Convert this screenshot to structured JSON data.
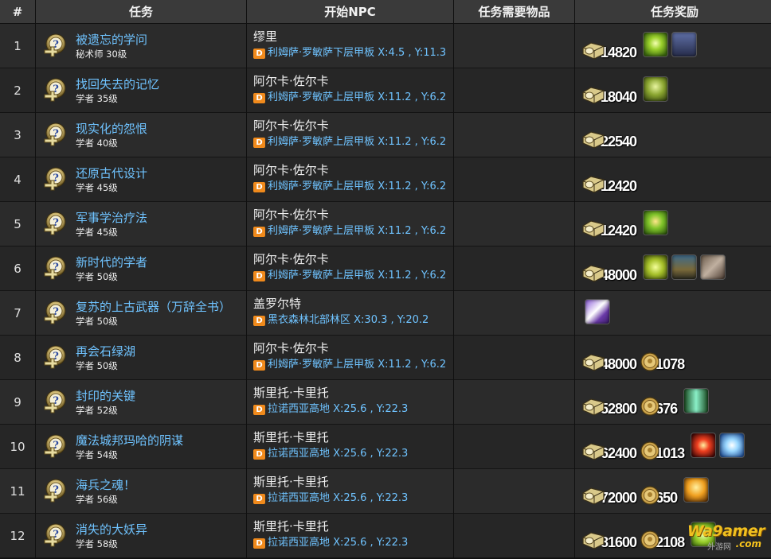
{
  "headers": {
    "num": "#",
    "quest": "任务",
    "npc": "开始NPC",
    "items": "任务需要物品",
    "reward": "任务奖励"
  },
  "rows": [
    {
      "num": "1",
      "name": "被遗忘的学问",
      "sub": "秘术师 30级",
      "npc": "缪里",
      "loc": "利姆萨·罗敏萨下层甲板 X:4.5 , Y:11.3",
      "rewards": [
        {
          "type": "gil",
          "value": "14820"
        }
      ],
      "items": [
        "item-green-burst",
        "item-blue-hat"
      ]
    },
    {
      "num": "2",
      "name": "找回失去的记忆",
      "sub": "学者 35级",
      "npc": "阿尔卡·佐尔卡",
      "loc": "利姆萨·罗敏萨上层甲板 X:11.2 , Y:6.2",
      "rewards": [
        {
          "type": "gil",
          "value": "18040"
        }
      ],
      "items": [
        "item-green-figure"
      ]
    },
    {
      "num": "3",
      "name": "现实化的怨恨",
      "sub": "学者 40级",
      "npc": "阿尔卡·佐尔卡",
      "loc": "利姆萨·罗敏萨上层甲板 X:11.2 , Y:6.2",
      "rewards": [
        {
          "type": "gil",
          "value": "22540"
        }
      ],
      "items": []
    },
    {
      "num": "4",
      "name": "还原古代设计",
      "sub": "学者 45级",
      "npc": "阿尔卡·佐尔卡",
      "loc": "利姆萨·罗敏萨上层甲板 X:11.2 , Y:6.2",
      "rewards": [
        {
          "type": "gil",
          "value": "12420"
        }
      ],
      "items": []
    },
    {
      "num": "5",
      "name": "军事学治疗法",
      "sub": "学者 45级",
      "npc": "阿尔卡·佐尔卡",
      "loc": "利姆萨·罗敏萨上层甲板 X:11.2 , Y:6.2",
      "rewards": [
        {
          "type": "gil",
          "value": "12420"
        }
      ],
      "items": [
        "item-green-heal"
      ]
    },
    {
      "num": "6",
      "name": "新时代的学者",
      "sub": "学者 50级",
      "npc": "阿尔卡·佐尔卡",
      "loc": "利姆萨·罗敏萨上层甲板 X:11.2 , Y:6.2",
      "rewards": [
        {
          "type": "gil",
          "value": "48000"
        }
      ],
      "items": [
        "item-green-shield",
        "item-armor",
        "item-gloves"
      ]
    },
    {
      "num": "7",
      "name": "复苏的上古武器（万辞全书）",
      "sub": "学者 50级",
      "npc": "盖罗尔特",
      "loc": "黑衣森林北部林区 X:30.3 , Y:20.2",
      "rewards": [],
      "items": [
        "item-purple-book"
      ]
    },
    {
      "num": "8",
      "name": "再会石绿湖",
      "sub": "学者 50级",
      "npc": "阿尔卡·佐尔卡",
      "loc": "利姆萨·罗敏萨上层甲板 X:11.2 , Y:6.2",
      "rewards": [
        {
          "type": "gil",
          "value": "48000"
        },
        {
          "type": "seal",
          "value": "1078"
        }
      ],
      "items": []
    },
    {
      "num": "9",
      "name": "封印的关键",
      "sub": "学者 52级",
      "npc": "斯里托·卡里托",
      "loc": "拉诺西亚高地 X:25.6 , Y:22.3",
      "rewards": [
        {
          "type": "gil",
          "value": "52800"
        },
        {
          "type": "seal",
          "value": "676"
        }
      ],
      "items": [
        "item-green-pillar"
      ]
    },
    {
      "num": "10",
      "name": "魔法城邦玛哈的阴谋",
      "sub": "学者 54级",
      "npc": "斯里托·卡里托",
      "loc": "拉诺西亚高地 X:25.6 , Y:22.3",
      "rewards": [
        {
          "type": "gil",
          "value": "62400"
        },
        {
          "type": "seal",
          "value": "1013"
        }
      ],
      "items": [
        "item-red-burst",
        "item-ice-cross"
      ]
    },
    {
      "num": "11",
      "name": "海兵之魂！",
      "sub": "学者 56级",
      "npc": "斯里托·卡里托",
      "loc": "拉诺西亚高地 X:25.6 , Y:22.3",
      "rewards": [
        {
          "type": "gil",
          "value": "72000"
        },
        {
          "type": "seal",
          "value": "650"
        }
      ],
      "items": [
        "item-orange-figure"
      ]
    },
    {
      "num": "12",
      "name": "消失的大妖异",
      "sub": "学者 58级",
      "npc": "斯里托·卡里托",
      "loc": "拉诺西亚高地 X:25.6 , Y:22.3",
      "rewards": [
        {
          "type": "gil",
          "value": "81600"
        },
        {
          "type": "seal",
          "value": "2108"
        }
      ],
      "items": [
        "item-green-partial"
      ]
    }
  ],
  "loc_badge": "D",
  "watermark": {
    "main": "Wa9amer",
    "sub": ".com",
    "cn": "外游网"
  },
  "colors": {
    "link": "#6fc3ff",
    "header_bg": "#3a3a3a",
    "row_bg": "#2b2b2b",
    "badge": "#f08a1c"
  }
}
